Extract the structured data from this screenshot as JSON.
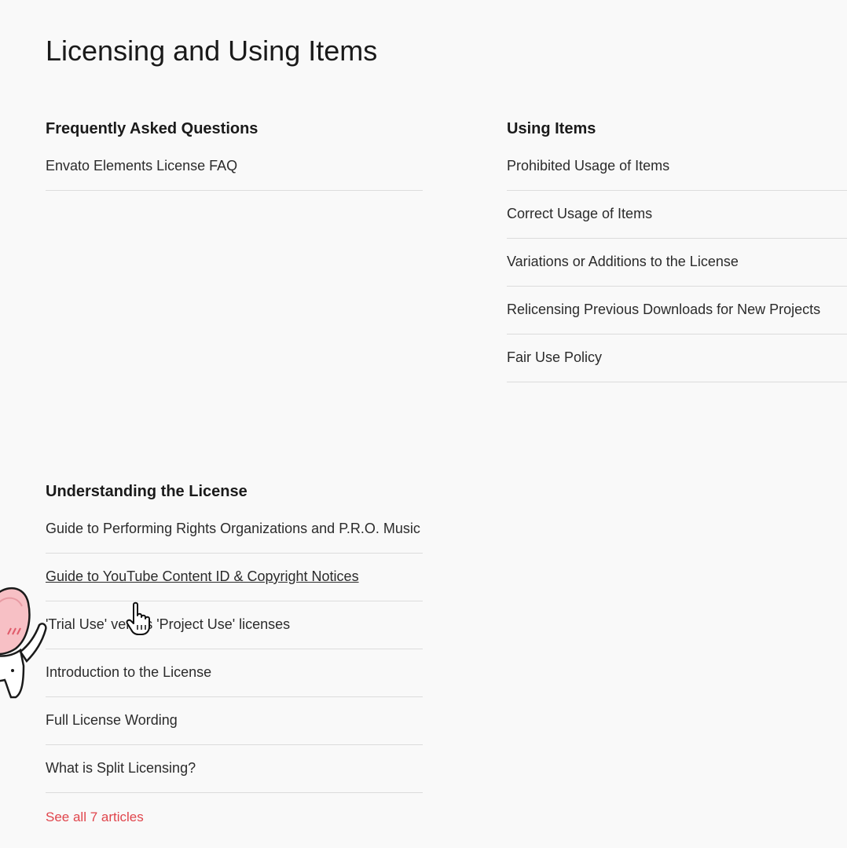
{
  "page": {
    "title": "Licensing and Using Items"
  },
  "sections": {
    "faq": {
      "heading": "Frequently Asked Questions",
      "articles": [
        "Envato Elements License FAQ"
      ]
    },
    "using": {
      "heading": "Using Items",
      "articles": [
        "Prohibited Usage of Items",
        "Correct Usage of Items",
        "Variations or Additions to the License",
        "Relicensing Previous Downloads for New Projects",
        "Fair Use Policy"
      ]
    },
    "understanding": {
      "heading": "Understanding the License",
      "articles": [
        "Guide to Performing Rights Organizations and P.R.O. Music",
        "Guide to YouTube Content ID & Copyright Notices",
        "'Trial Use' versus 'Project Use' licenses",
        "Introduction to the License",
        "Full License Wording",
        "What is Split Licensing?"
      ],
      "see_all": "See all 7 articles"
    }
  },
  "colors": {
    "background": "#f9f9f9",
    "link": "#2b2b2b",
    "accent": "#e0454c",
    "divider": "#dcdcdc"
  },
  "icons": {
    "mascot": "peach-character-sticker",
    "cursor": "hand-pointer-cursor"
  }
}
